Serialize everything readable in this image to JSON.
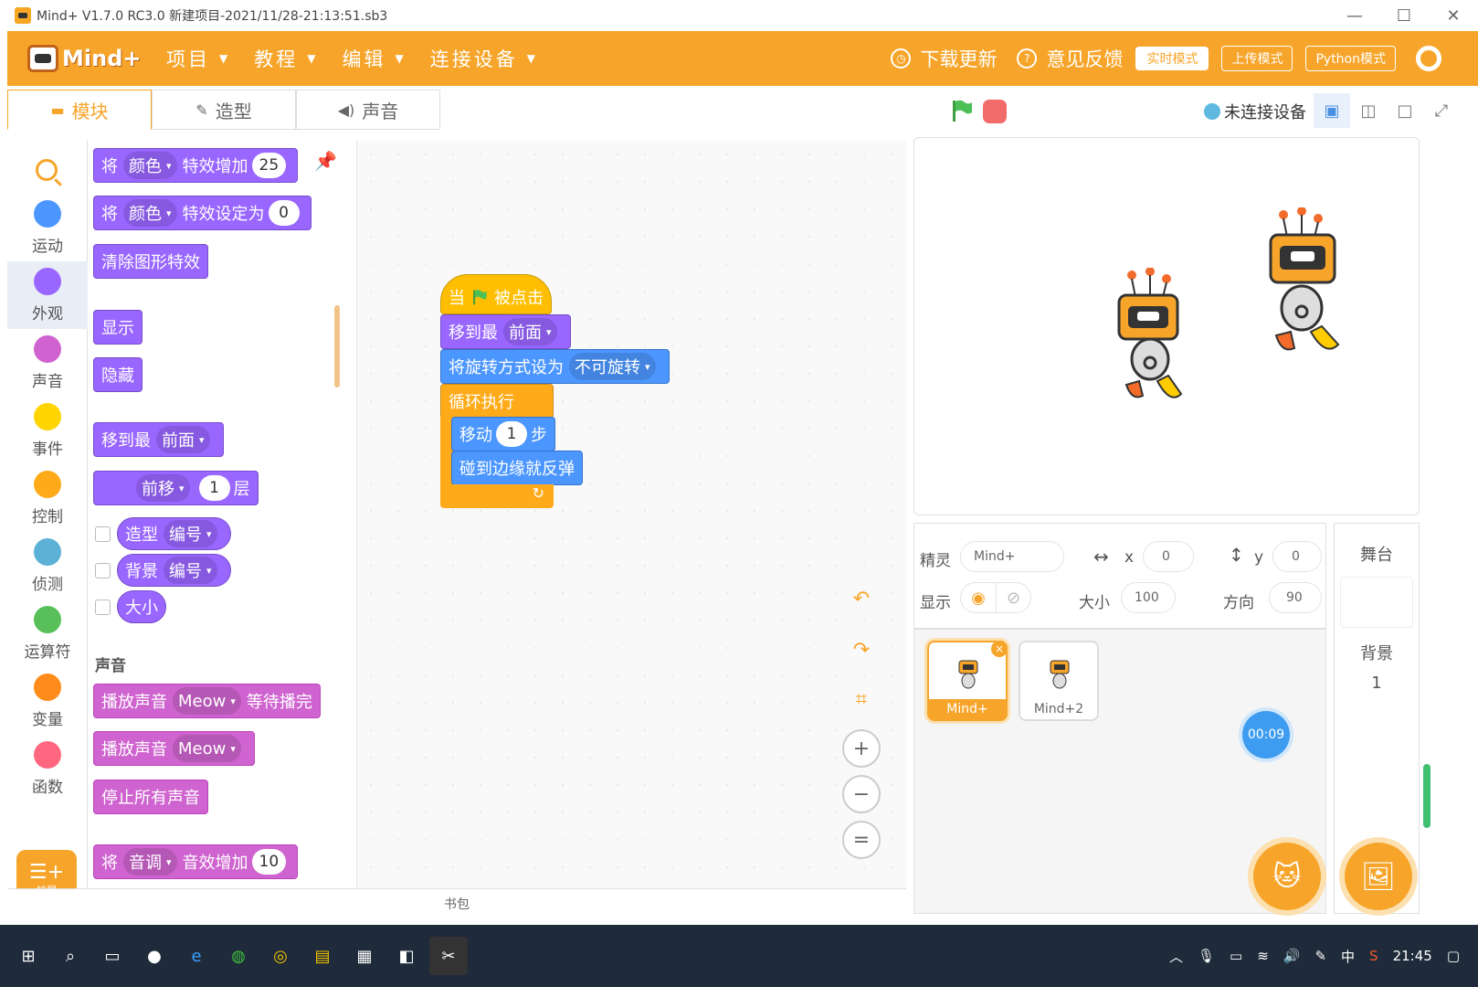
{
  "window": {
    "title": "Mind+ V1.7.0 RC3.0    新建项目-2021/11/28-21:13:51.sb3",
    "controls": [
      "—",
      "☐",
      "✕"
    ]
  },
  "menubar": {
    "logo": "Mind+",
    "items": [
      "项目",
      "教程",
      "编辑",
      "连接设备"
    ],
    "right": {
      "update": "下载更新",
      "feedback": "意见反馈",
      "mode_realtime": "实时模式",
      "mode_upload": "上传模式",
      "python": "Python模式"
    }
  },
  "tabs": [
    "模块",
    "造型",
    "声音"
  ],
  "device_status": "未连接设备",
  "categories": [
    {
      "label": "运动",
      "color": "#4c97ff"
    },
    {
      "label": "外观",
      "color": "#9966ff"
    },
    {
      "label": "声音",
      "color": "#cf63cf"
    },
    {
      "label": "事件",
      "color": "#ffd500"
    },
    {
      "label": "控制",
      "color": "#ffab19"
    },
    {
      "label": "侦测",
      "color": "#5cb1d6"
    },
    {
      "label": "运算符",
      "color": "#59c059"
    },
    {
      "label": "变量",
      "color": "#ff8c1a"
    },
    {
      "label": "函数",
      "color": "#ff6680"
    }
  ],
  "extension_label": "扩展",
  "palette": {
    "b1": {
      "a": "将",
      "dd": "颜色",
      "b": "特效增加",
      "num": "25"
    },
    "b2": {
      "a": "将",
      "dd": "颜色",
      "b": "特效设定为",
      "num": "0"
    },
    "b3": "清除图形特效",
    "b4": "显示",
    "b5": "隐藏",
    "b6": {
      "a": "移到最",
      "dd": "前面"
    },
    "b7": {
      "dd": "前移",
      "num": "1",
      "b": "层"
    },
    "b8": {
      "a": "造型",
      "dd": "编号"
    },
    "b9": {
      "a": "背景",
      "dd": "编号"
    },
    "b10": "大小",
    "sound_header": "声音",
    "s1": {
      "a": "播放声音",
      "dd": "Meow",
      "b": "等待播完"
    },
    "s2": {
      "a": "播放声音",
      "dd": "Meow"
    },
    "s3": "停止所有声音",
    "s4": {
      "a": "将",
      "dd": "音调",
      "b": "音效增加",
      "num": "10"
    }
  },
  "script": {
    "hat": {
      "a": "当",
      "b": "被点击"
    },
    "front": {
      "a": "移到最",
      "dd": "前面"
    },
    "rotation": {
      "a": "将旋转方式设为",
      "dd": "不可旋转"
    },
    "loop": "循环执行",
    "move": {
      "a": "移动",
      "num": "1",
      "b": "步"
    },
    "bounce": "碰到边缘就反弹",
    "loop_arrow": "↻"
  },
  "backpack": "书包",
  "sprite_info": {
    "sprite_label": "精灵",
    "sprite_name": "Mind+",
    "x_label": "x",
    "x": "0",
    "y_label": "y",
    "y": "0",
    "show_label": "显示",
    "size_label": "大小",
    "size": "100",
    "dir_label": "方向",
    "dir": "90"
  },
  "sprites": [
    "Mind+",
    "Mind+2"
  ],
  "timer": "00:09",
  "stage_panel": {
    "title": "舞台",
    "bg_label": "背景",
    "bg_count": "1"
  },
  "taskbar": {
    "time": "21:45",
    "ime": "中"
  }
}
